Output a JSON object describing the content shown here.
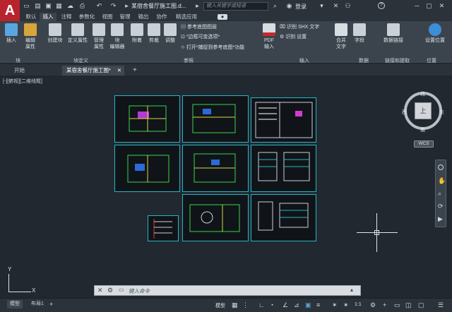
{
  "app": {
    "logo": "A"
  },
  "title_bar": {
    "doc_title": "某宿舍餐厅施工图.d...",
    "search_placeholder": "键入关键字或短语",
    "login": "登录",
    "help": "?"
  },
  "ribbon_tabs": [
    "默认",
    "插入",
    "注释",
    "参数化",
    "视图",
    "管理",
    "输出",
    "协作",
    "精选应用"
  ],
  "ribbon_active_tab": "插入",
  "ribbon": {
    "block_panel": {
      "insert": "插入",
      "edit_attr_1": "编辑",
      "edit_attr_2": "属性",
      "label": "块"
    },
    "block_def_panel": {
      "create": "创建块",
      "define_attr": "定义属性",
      "manage_attr_1": "管理",
      "manage_attr_2": "属性",
      "block_editor_1": "块",
      "block_editor_2": "编辑器",
      "label": "块定义"
    },
    "reference_panel": {
      "attach": "附着",
      "clip": "剪裁",
      "adjust": "调整",
      "underlay_layers": "参考底图图层",
      "frames_vary": "*边框可变选项*",
      "snap_underlay": "打开*捕捉到参考底图*功能",
      "label": "参照"
    },
    "import_panel": {
      "pdf_1": "PDF",
      "pdf_2": "输入",
      "recognize_shx": "识别 SHX 文字",
      "recognize_settings": "识别 设置",
      "label": "输入"
    },
    "combine": {
      "merge_1": "合并",
      "merge_2": "文字"
    },
    "data_panel": {
      "field": "字段",
      "data_link": "数据链接",
      "label": "数据"
    },
    "link_panel": {
      "label": "链接和提取"
    },
    "location_panel": {
      "set_location_1": "设置位置",
      "label": "位置"
    }
  },
  "file_tabs": {
    "start": "开始",
    "active_doc": "某宿舍餐厅施工图*",
    "add": "+"
  },
  "viewport": {
    "label": "[-][俯视][二维线框]",
    "compass": {
      "north": "北",
      "south": "南",
      "east": "东",
      "west": "西",
      "center": "上"
    },
    "wcs": "WCS"
  },
  "command_line": {
    "placeholder": "键入命令"
  },
  "status_bar": {
    "tab_model": "模型",
    "tab_layout1": "布局1",
    "tab_add": "+",
    "model_mode": "模型",
    "scale": "1:1"
  },
  "colors": {
    "sheet_border": "#27b6c4",
    "accent_red": "#b8232c",
    "background": "#212830"
  }
}
